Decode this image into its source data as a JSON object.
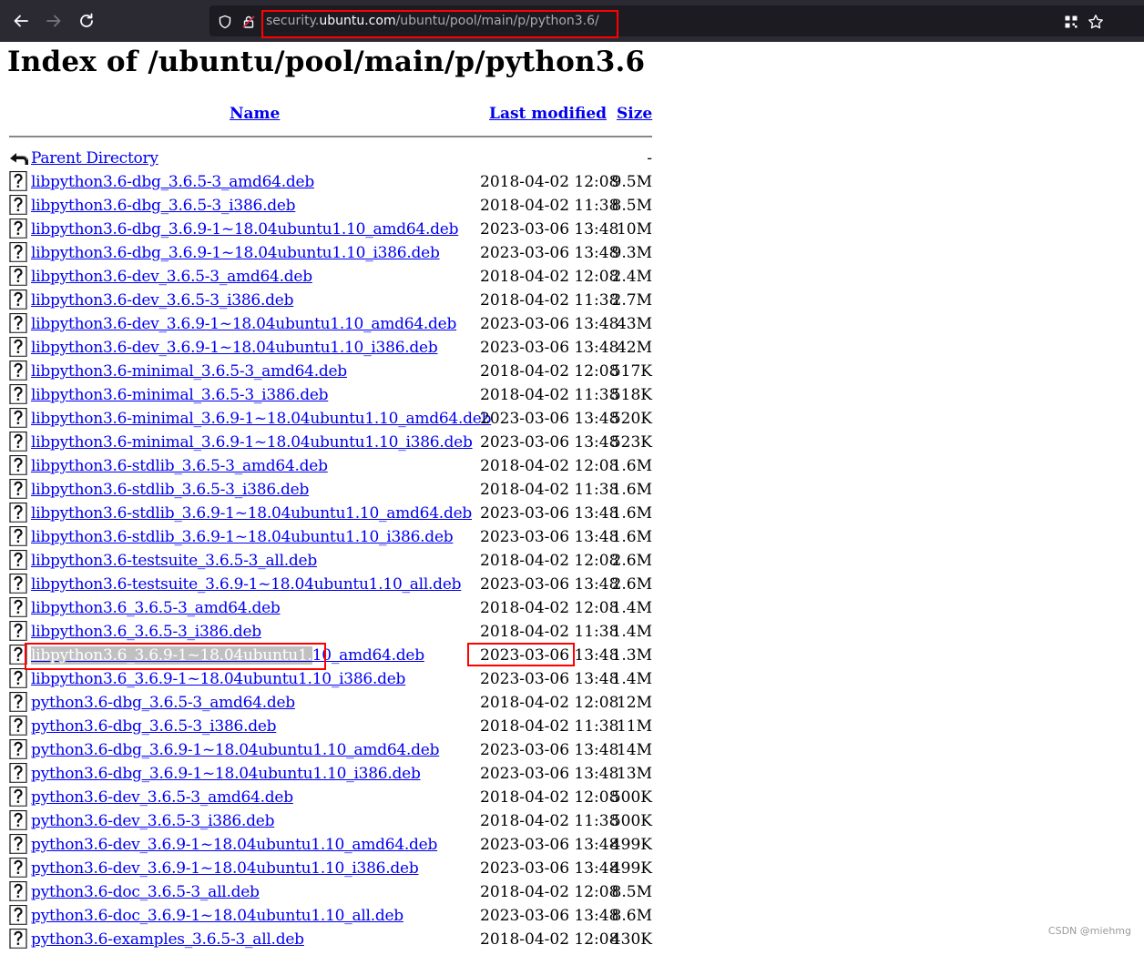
{
  "browser": {
    "url_domain_prefix": "security.",
    "url_domain": "ubuntu.com",
    "url_path": "/ubuntu/pool/main/p/python3.6/"
  },
  "page": {
    "title": "Index of /ubuntu/pool/main/p/python3.6",
    "columns": {
      "name": "Name",
      "last_modified": "Last modified",
      "size": "Size"
    }
  },
  "parent": {
    "label": "Parent Directory",
    "size": "-"
  },
  "rows": [
    {
      "name": "libpython3.6-dbg_3.6.5-3_amd64.deb",
      "date": "2018-04-02 12:08",
      "size": "9.5M"
    },
    {
      "name": "libpython3.6-dbg_3.6.5-3_i386.deb",
      "date": "2018-04-02 11:38",
      "size": "8.5M"
    },
    {
      "name": "libpython3.6-dbg_3.6.9-1~18.04ubuntu1.10_amd64.deb",
      "date": "2023-03-06 13:48",
      "size": "10M"
    },
    {
      "name": "libpython3.6-dbg_3.6.9-1~18.04ubuntu1.10_i386.deb",
      "date": "2023-03-06 13:48",
      "size": "9.3M"
    },
    {
      "name": "libpython3.6-dev_3.6.5-3_amd64.deb",
      "date": "2018-04-02 12:08",
      "size": "2.4M"
    },
    {
      "name": "libpython3.6-dev_3.6.5-3_i386.deb",
      "date": "2018-04-02 11:38",
      "size": "2.7M"
    },
    {
      "name": "libpython3.6-dev_3.6.9-1~18.04ubuntu1.10_amd64.deb",
      "date": "2023-03-06 13:48",
      "size": "43M"
    },
    {
      "name": "libpython3.6-dev_3.6.9-1~18.04ubuntu1.10_i386.deb",
      "date": "2023-03-06 13:48",
      "size": "42M"
    },
    {
      "name": "libpython3.6-minimal_3.6.5-3_amd64.deb",
      "date": "2018-04-02 12:08",
      "size": "517K"
    },
    {
      "name": "libpython3.6-minimal_3.6.5-3_i386.deb",
      "date": "2018-04-02 11:38",
      "size": "518K"
    },
    {
      "name": "libpython3.6-minimal_3.6.9-1~18.04ubuntu1.10_amd64.deb",
      "date": "2023-03-06 13:48",
      "size": "520K"
    },
    {
      "name": "libpython3.6-minimal_3.6.9-1~18.04ubuntu1.10_i386.deb",
      "date": "2023-03-06 13:48",
      "size": "523K"
    },
    {
      "name": "libpython3.6-stdlib_3.6.5-3_amd64.deb",
      "date": "2018-04-02 12:08",
      "size": "1.6M"
    },
    {
      "name": "libpython3.6-stdlib_3.6.5-3_i386.deb",
      "date": "2018-04-02 11:38",
      "size": "1.6M"
    },
    {
      "name": "libpython3.6-stdlib_3.6.9-1~18.04ubuntu1.10_amd64.deb",
      "date": "2023-03-06 13:48",
      "size": "1.6M"
    },
    {
      "name": "libpython3.6-stdlib_3.6.9-1~18.04ubuntu1.10_i386.deb",
      "date": "2023-03-06 13:48",
      "size": "1.6M"
    },
    {
      "name": "libpython3.6-testsuite_3.6.5-3_all.deb",
      "date": "2018-04-02 12:08",
      "size": "2.6M"
    },
    {
      "name": "libpython3.6-testsuite_3.6.9-1~18.04ubuntu1.10_all.deb",
      "date": "2023-03-06 13:48",
      "size": "2.6M"
    },
    {
      "name": "libpython3.6_3.6.5-3_amd64.deb",
      "date": "2018-04-02 12:08",
      "size": "1.4M"
    },
    {
      "name": "libpython3.6_3.6.5-3_i386.deb",
      "date": "2018-04-02 11:38",
      "size": "1.4M"
    },
    {
      "name": "libpython3.6_3.6.9-1~18.04ubuntu1.10_amd64.deb",
      "date": "2023-03-06 13:48",
      "size": "1.3M",
      "selected": "libpython3.6_3.6.9-1~18.04ubuntu1.",
      "rest": "10_amd64.deb"
    },
    {
      "name": "libpython3.6_3.6.9-1~18.04ubuntu1.10_i386.deb",
      "date": "2023-03-06 13:48",
      "size": "1.4M"
    },
    {
      "name": "python3.6-dbg_3.6.5-3_amd64.deb",
      "date": "2018-04-02 12:08",
      "size": "12M"
    },
    {
      "name": "python3.6-dbg_3.6.5-3_i386.deb",
      "date": "2018-04-02 11:38",
      "size": "11M"
    },
    {
      "name": "python3.6-dbg_3.6.9-1~18.04ubuntu1.10_amd64.deb",
      "date": "2023-03-06 13:48",
      "size": "14M"
    },
    {
      "name": "python3.6-dbg_3.6.9-1~18.04ubuntu1.10_i386.deb",
      "date": "2023-03-06 13:48",
      "size": "13M"
    },
    {
      "name": "python3.6-dev_3.6.5-3_amd64.deb",
      "date": "2018-04-02 12:08",
      "size": "500K"
    },
    {
      "name": "python3.6-dev_3.6.5-3_i386.deb",
      "date": "2018-04-02 11:38",
      "size": "500K"
    },
    {
      "name": "python3.6-dev_3.6.9-1~18.04ubuntu1.10_amd64.deb",
      "date": "2023-03-06 13:48",
      "size": "499K"
    },
    {
      "name": "python3.6-dev_3.6.9-1~18.04ubuntu1.10_i386.deb",
      "date": "2023-03-06 13:48",
      "size": "499K"
    },
    {
      "name": "python3.6-doc_3.6.5-3_all.deb",
      "date": "2018-04-02 12:08",
      "size": "8.5M"
    },
    {
      "name": "python3.6-doc_3.6.9-1~18.04ubuntu1.10_all.deb",
      "date": "2023-03-06 13:48",
      "size": "8.6M"
    },
    {
      "name": "python3.6-examples_3.6.5-3_all.deb",
      "date": "2018-04-02 12:08",
      "size": "430K"
    }
  ],
  "watermark": "CSDN @miehmg",
  "colors": {
    "toolbar": "#2b2a33",
    "urlbar": "#1c1b22",
    "link": "#0000ee",
    "annotation": "#ff0000"
  }
}
